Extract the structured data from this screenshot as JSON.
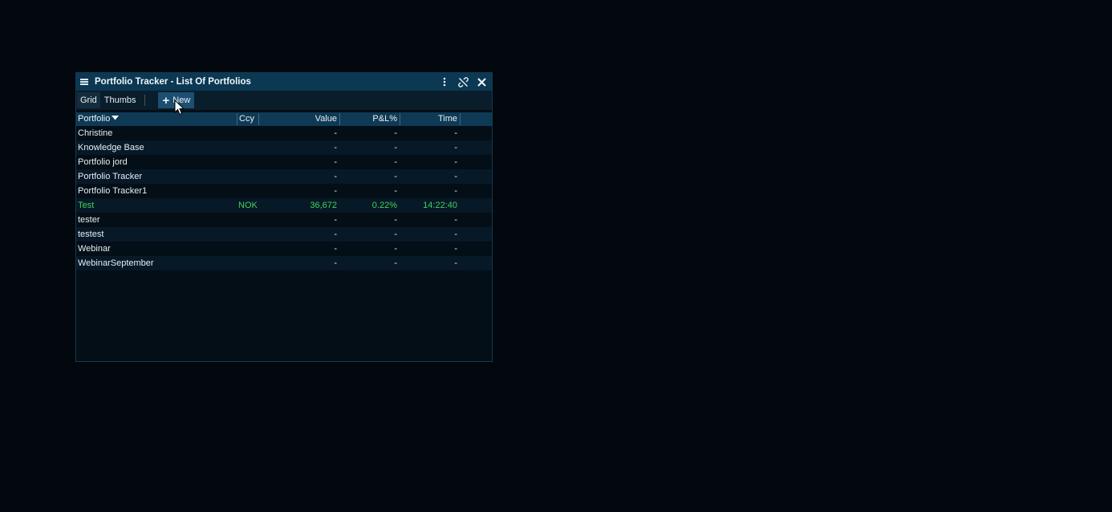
{
  "window": {
    "title": "Portfolio Tracker - List Of Portfolios"
  },
  "toolbar": {
    "grid_label": "Grid",
    "thumbs_label": "Thumbs",
    "new_label": "New"
  },
  "table": {
    "columns": [
      "Portfolio",
      "Ccy",
      "Value",
      "P&L%",
      "Time"
    ],
    "sort_column": "Portfolio",
    "rows": [
      {
        "portfolio": "Christine",
        "ccy": "",
        "value": "-",
        "pl": "-",
        "time": "-"
      },
      {
        "portfolio": "Knowledge Base",
        "ccy": "",
        "value": "-",
        "pl": "-",
        "time": "-"
      },
      {
        "portfolio": "Portfolio jord",
        "ccy": "",
        "value": "-",
        "pl": "-",
        "time": "-"
      },
      {
        "portfolio": "Portfolio Tracker",
        "ccy": "",
        "value": "-",
        "pl": "-",
        "time": "-"
      },
      {
        "portfolio": "Portfolio Tracker1",
        "ccy": "",
        "value": "-",
        "pl": "-",
        "time": "-"
      },
      {
        "portfolio": "Test",
        "ccy": "NOK",
        "value": "36,672",
        "pl": "0.22%",
        "time": "14:22:40"
      },
      {
        "portfolio": "tester",
        "ccy": "",
        "value": "-",
        "pl": "-",
        "time": "-"
      },
      {
        "portfolio": "testest",
        "ccy": "",
        "value": "-",
        "pl": "-",
        "time": "-"
      },
      {
        "portfolio": "Webinar",
        "ccy": "",
        "value": "-",
        "pl": "-",
        "time": "-"
      },
      {
        "portfolio": "WebinarSeptember",
        "ccy": "",
        "value": "-",
        "pl": "-",
        "time": "-"
      }
    ]
  },
  "colors": {
    "positive": "#40d25a",
    "titlebar": "#0b3852",
    "header": "#0f3a55",
    "new_button": "#1c4f72"
  }
}
